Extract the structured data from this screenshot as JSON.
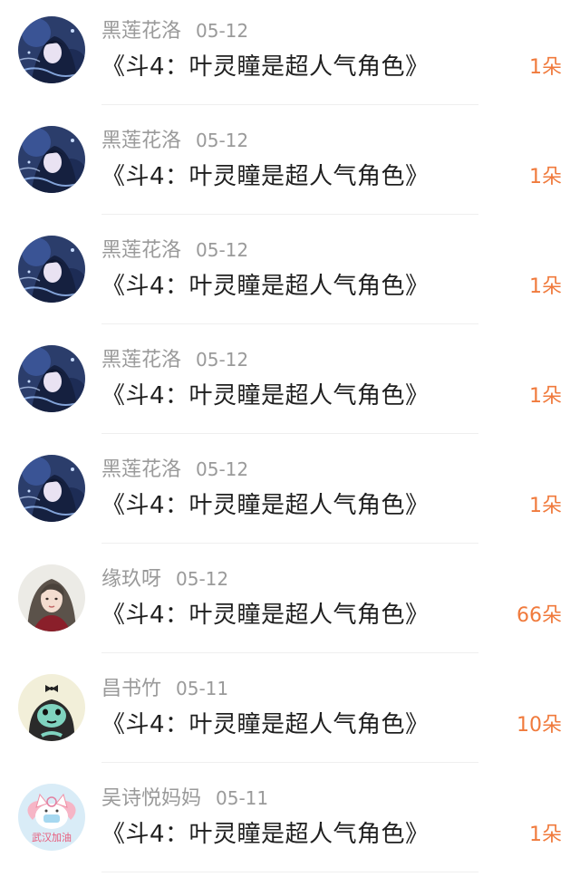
{
  "items": [
    {
      "user": "黑莲花洛",
      "date": "05-12",
      "title": "《斗4：叶灵瞳是超人气角色》",
      "count": "1朵",
      "avatar_icon": "anime-girl-avatar"
    },
    {
      "user": "黑莲花洛",
      "date": "05-12",
      "title": "《斗4：叶灵瞳是超人气角色》",
      "count": "1朵",
      "avatar_icon": "anime-girl-avatar"
    },
    {
      "user": "黑莲花洛",
      "date": "05-12",
      "title": "《斗4：叶灵瞳是超人气角色》",
      "count": "1朵",
      "avatar_icon": "anime-girl-avatar"
    },
    {
      "user": "黑莲花洛",
      "date": "05-12",
      "title": "《斗4：叶灵瞳是超人气角色》",
      "count": "1朵",
      "avatar_icon": "anime-girl-avatar"
    },
    {
      "user": "黑莲花洛",
      "date": "05-12",
      "title": "《斗4：叶灵瞳是超人气角色》",
      "count": "1朵",
      "avatar_icon": "anime-girl-avatar"
    },
    {
      "user": "缘玖呀",
      "date": "05-12",
      "title": "《斗4：叶灵瞳是超人气角色》",
      "count": "66朵",
      "avatar_icon": "girl-portrait-avatar"
    },
    {
      "user": "昌书竹",
      "date": "05-11",
      "title": "《斗4：叶灵瞳是超人气角色》",
      "count": "10朵",
      "avatar_icon": "monkey-bowtie-avatar"
    },
    {
      "user": "吴诗悦妈妈",
      "date": "05-11",
      "title": "《斗4：叶灵瞳是超人气角色》",
      "count": "1朵",
      "avatar_icon": "cat-mask-avatar",
      "avatar_caption": "武汉加油"
    }
  ],
  "colors": {
    "username": "#9a9a9a",
    "title": "#1f1f1f",
    "count_accent": "#f07a3c",
    "divider": "#efefef"
  }
}
